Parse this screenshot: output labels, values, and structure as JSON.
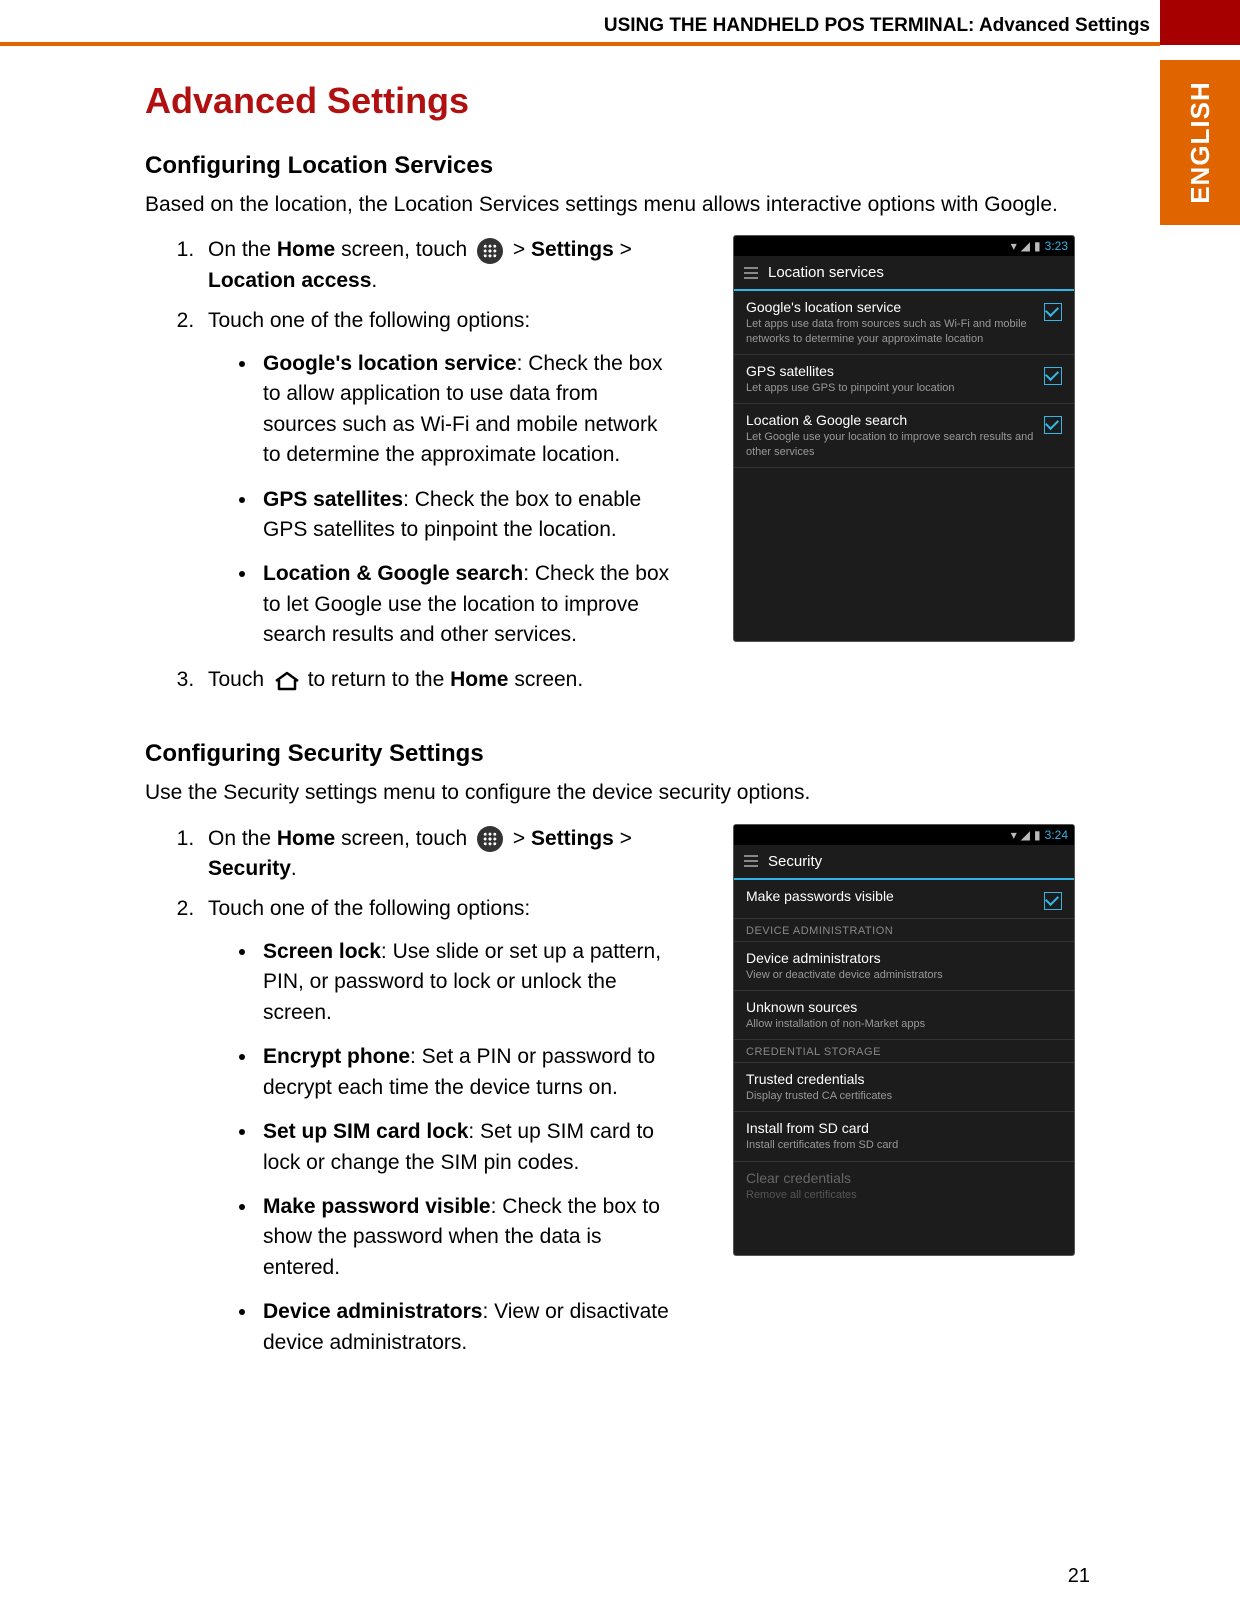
{
  "header": {
    "running_title": "USING THE HANDHELD POS TERMINAL: Advanced Settings",
    "language_tab": "ENGLISH",
    "page_number": "21"
  },
  "doc": {
    "title": "Advanced Settings",
    "section1": {
      "heading": "Configuring Location Services",
      "intro": "Based on the location, the Location Services settings menu allows interactive options with Google.",
      "step1_pre": "On the ",
      "step1_home": "Home",
      "step1_mid": " screen, touch ",
      "step1_gt1": " > ",
      "step1_settings": "Settings",
      "step1_gt2": " > ",
      "step1_loc": "Location access",
      "step1_end": ".",
      "step2": "Touch one of the following options:",
      "b1_bold": "Google's location service",
      "b1_rest": ": Check the box to allow application to use data from sources such as Wi-Fi and mobile network to determine the approximate location.",
      "b2_bold": "GPS satellites",
      "b2_rest": ": Check the box to enable GPS satellites to pinpoint the location.",
      "b3_bold": "Location & Google search",
      "b3_rest": ": Check the box to let Google use the location to improve search results and other services.",
      "step3_pre": "Touch ",
      "step3_mid": " to return to the ",
      "step3_home": "Home",
      "step3_end": " screen."
    },
    "section2": {
      "heading": "Configuring Security Settings",
      "intro": "Use the Security settings menu to configure the device security options.",
      "step1_pre": "On the ",
      "step1_home": "Home",
      "step1_mid": " screen, touch ",
      "step1_gt1": " > ",
      "step1_settings": "Settings",
      "step1_gt2": " > ",
      "step1_sec": "Security",
      "step1_end": ".",
      "step2": "Touch one of the following options:",
      "b1_bold": "Screen lock",
      "b1_rest": ": Use slide or set up a pattern, PIN, or password to lock or unlock the screen.",
      "b2_bold": "Encrypt phone",
      "b2_rest": ": Set a PIN or password to decrypt each time the device turns on.",
      "b3_bold": "Set up SIM card lock",
      "b3_rest": ": Set up SIM card to lock or change the SIM pin codes.",
      "b4_bold": "Make password visible",
      "b4_rest": ": Check the box to show the password when the data is entered.",
      "b5_bold": "Device administrators",
      "b5_rest": ": View or disactivate device administrators."
    }
  },
  "shot1": {
    "time": "3:23",
    "title": "Location services",
    "items": [
      {
        "t": "Google's location service",
        "s": "Let apps use data from sources such as Wi-Fi and mobile networks to determine your approximate location"
      },
      {
        "t": "GPS satellites",
        "s": "Let apps use GPS to pinpoint your location"
      },
      {
        "t": "Location & Google search",
        "s": "Let Google use your location to improve search results and other services"
      }
    ]
  },
  "shot2": {
    "time": "3:24",
    "title": "Security",
    "row0": {
      "t": "Make passwords visible"
    },
    "sec1": "DEVICE ADMINISTRATION",
    "row1": {
      "t": "Device administrators",
      "s": "View or deactivate device administrators"
    },
    "row2": {
      "t": "Unknown sources",
      "s": "Allow installation of non-Market apps"
    },
    "sec2": "CREDENTIAL STORAGE",
    "row3": {
      "t": "Trusted credentials",
      "s": "Display trusted CA certificates"
    },
    "row4": {
      "t": "Install from SD card",
      "s": "Install certificates from SD card"
    },
    "row5": {
      "t": "Clear credentials",
      "s": "Remove all certificates"
    }
  }
}
